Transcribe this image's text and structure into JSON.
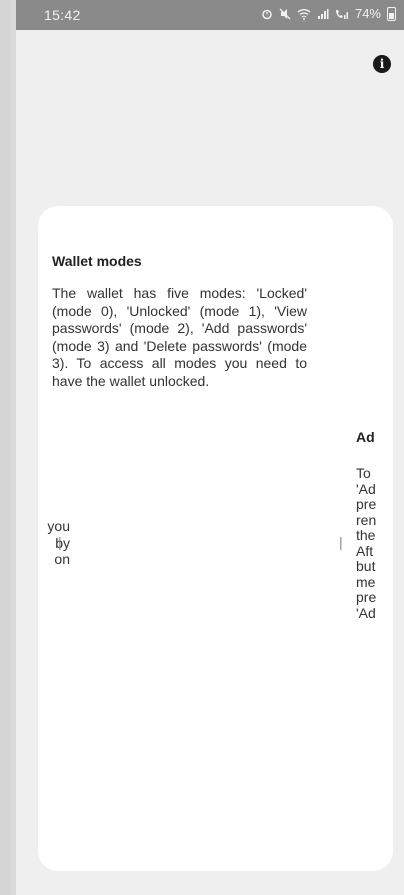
{
  "status_bar": {
    "time": "15:42",
    "battery_text": "74%"
  },
  "info_button": {
    "label": "i"
  },
  "current_card": {
    "title": "Wallet modes",
    "body": "The wallet has five modes: 'Locked' (mode 0), 'Unlocked' (mode 1), 'View passwords' (mode 2), 'Add passwords' (mode 3) and 'Delete passwords' (mode 3). To access all modes you need to have the wallet unlocked."
  },
  "previous_card": {
    "visible_lines": [
      "you",
      "by",
      "on"
    ]
  },
  "next_card": {
    "title_fragment": "Ad",
    "visible_lines": [
      "To",
      "'Ad",
      "pre",
      "ren",
      "the",
      "Aft",
      "but",
      "me",
      "pre",
      "'Ad"
    ]
  },
  "separator": "|"
}
